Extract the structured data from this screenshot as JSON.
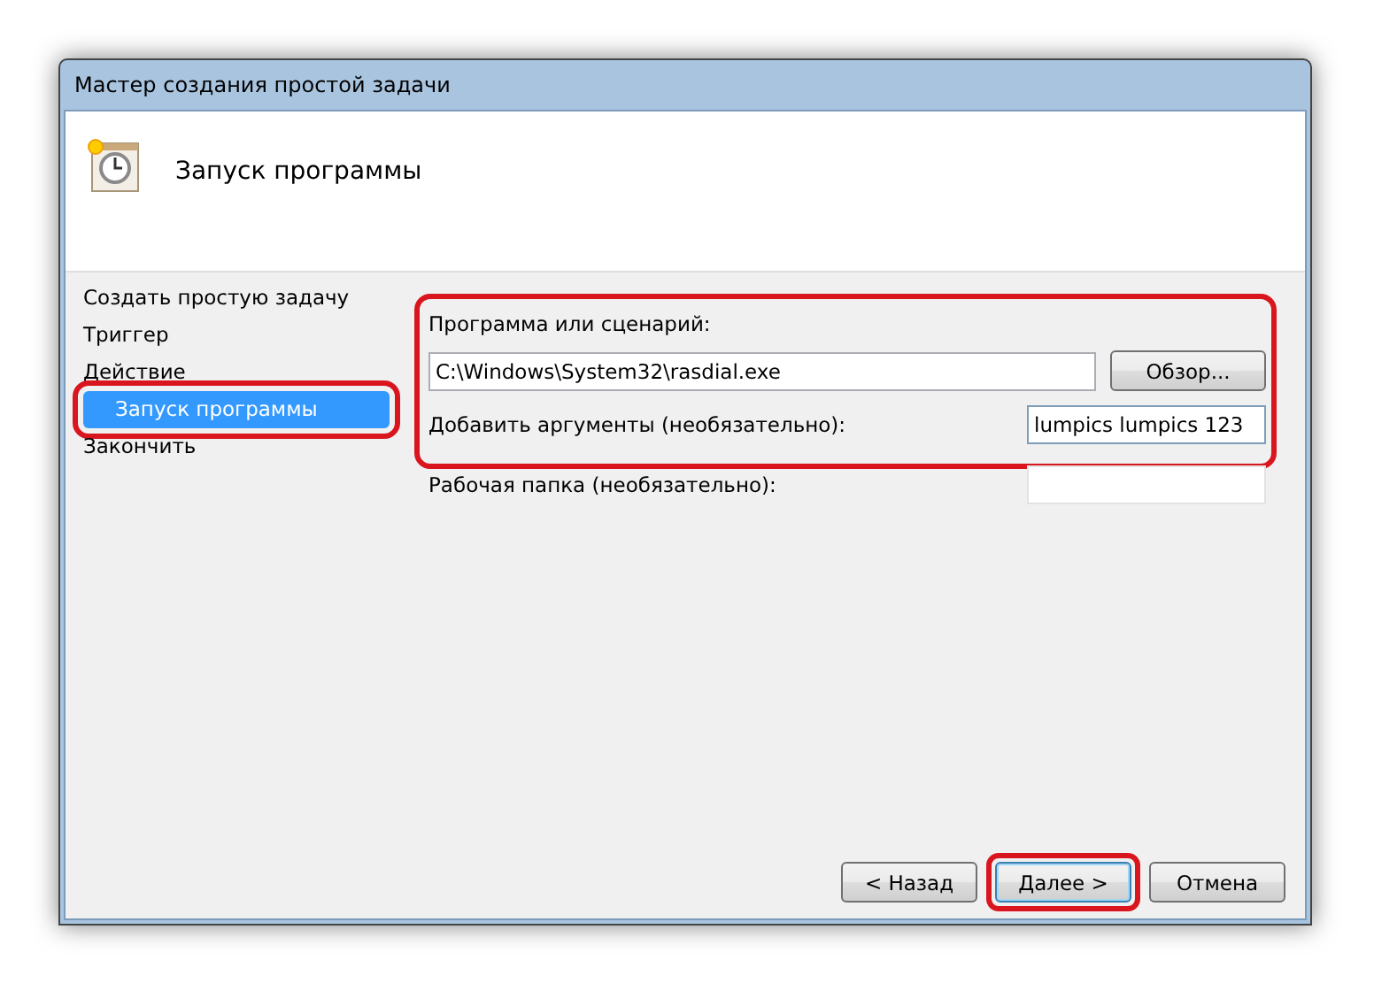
{
  "window": {
    "title": "Мастер создания простой задачи"
  },
  "header": {
    "title": "Запуск программы"
  },
  "steps": [
    {
      "label": "Создать простую задачу",
      "selected": false,
      "highlighted": false
    },
    {
      "label": "Триггер",
      "selected": false,
      "highlighted": false
    },
    {
      "label": "Действие",
      "selected": false,
      "highlighted": false
    },
    {
      "label": "Запуск программы",
      "selected": true,
      "highlighted": true
    },
    {
      "label": "Закончить",
      "selected": false,
      "highlighted": false
    }
  ],
  "form": {
    "highlighted": true,
    "program": {
      "label": "Программа или сценарий:",
      "value": "C:\\Windows\\System32\\rasdial.exe",
      "browse_button": "Обзор..."
    },
    "arguments": {
      "label": "Добавить аргументы (необязательно):",
      "value": "lumpics lumpics 123"
    },
    "working_folder": {
      "label": "Рабочая папка (необязательно):"
    }
  },
  "buttons": [
    {
      "label": "< Назад",
      "highlighted": false,
      "default": false
    },
    {
      "label": "Далее >",
      "highlighted": true,
      "default": true
    },
    {
      "label": "Отмена",
      "highlighted": false,
      "default": false
    }
  ]
}
